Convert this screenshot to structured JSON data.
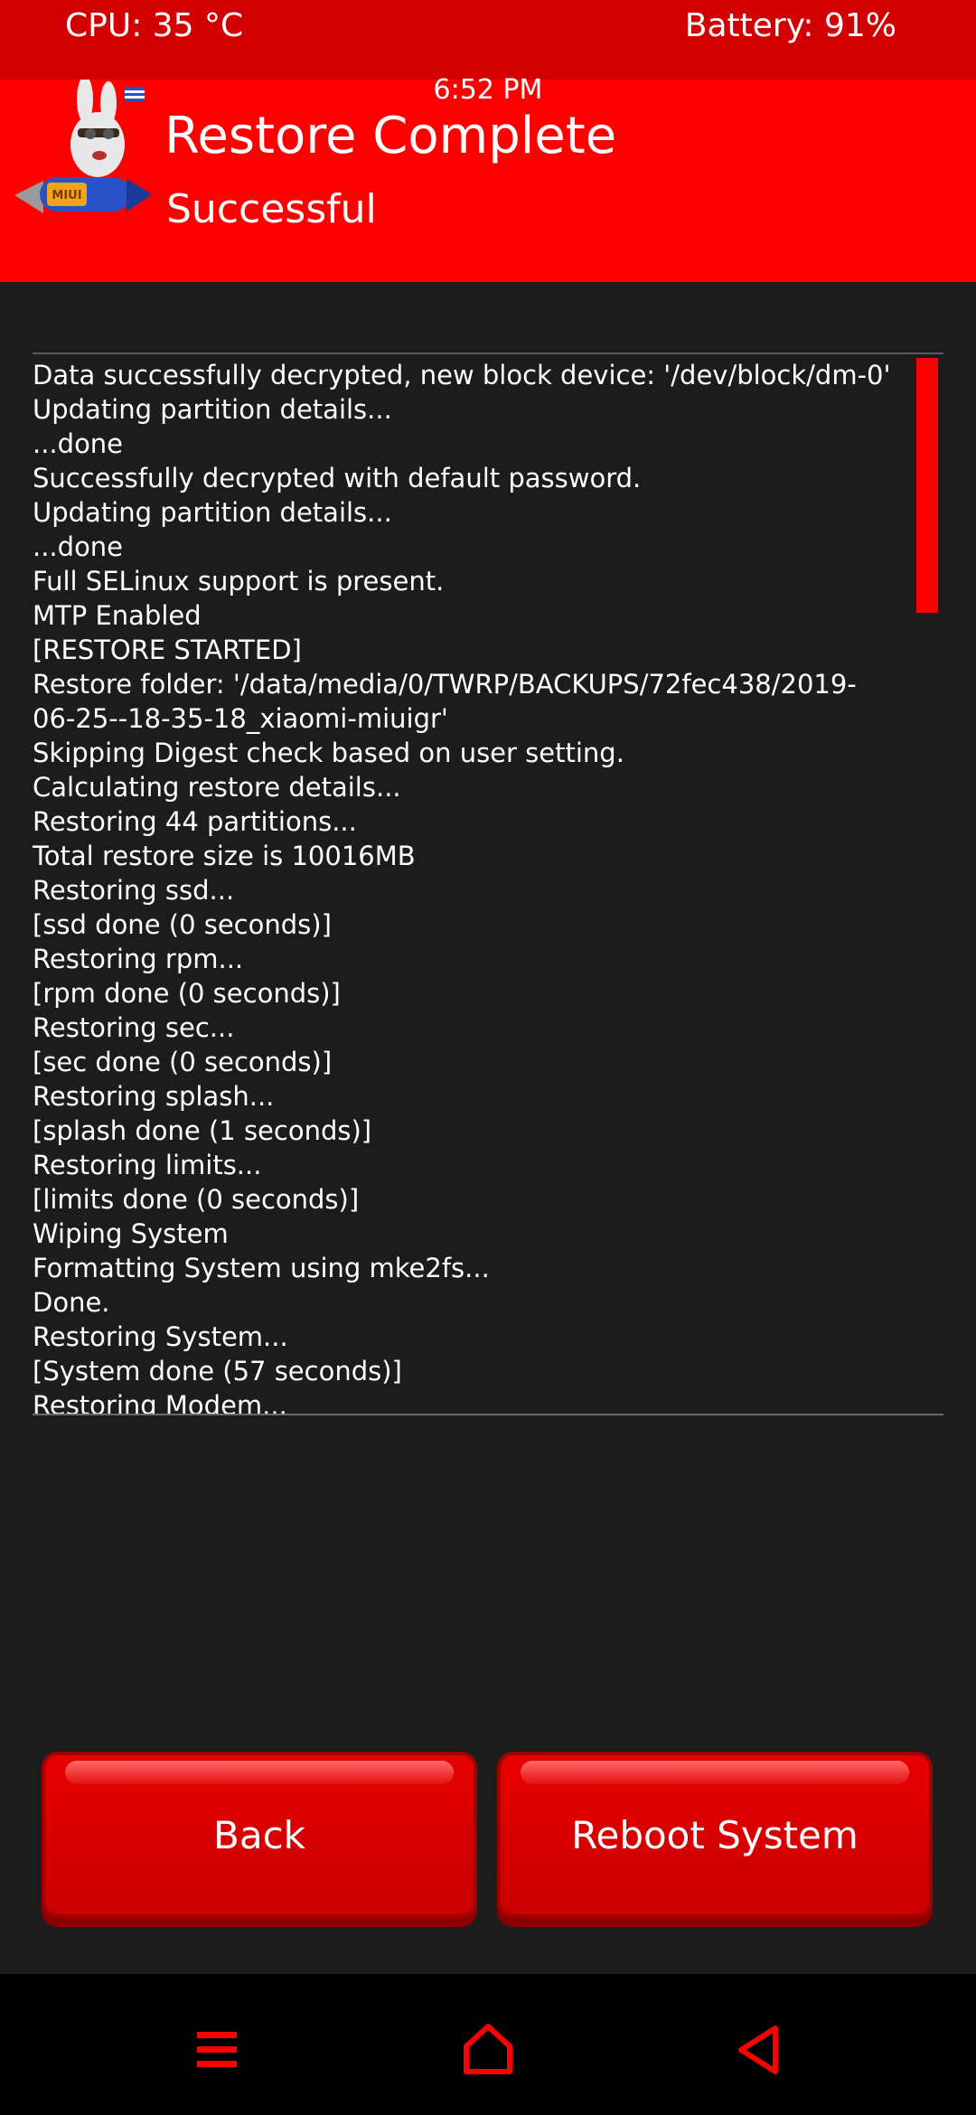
{
  "status_bar": {
    "cpu": "CPU: 35 °C",
    "battery": "Battery: 91%"
  },
  "header": {
    "time": "6:52 PM",
    "title": "Restore Complete",
    "subtitle": "Successful",
    "logo_icon": "miui-rocket-logo",
    "logo_text": "MIUI"
  },
  "console": {
    "lines": [
      "Data successfully decrypted, new block device: '/dev/block/dm-0'",
      "Updating partition details...",
      "...done",
      "Successfully decrypted with default password.",
      "Updating partition details...",
      "...done",
      "Full SELinux support is present.",
      "MTP Enabled",
      "[RESTORE STARTED]",
      "Restore folder: '/data/media/0/TWRP/BACKUPS/72fec438/2019-",
      "06-25--18-35-18_xiaomi-miuigr'",
      "Skipping Digest check based on user setting.",
      "Calculating restore details...",
      "Restoring 44 partitions...",
      "Total restore size is 10016MB",
      "Restoring ssd...",
      "[ssd done (0 seconds)]",
      "Restoring rpm...",
      "[rpm done (0 seconds)]",
      "Restoring sec...",
      "[sec done (0 seconds)]",
      "Restoring splash...",
      "[splash done (1 seconds)]",
      "Restoring limits...",
      "[limits done (0 seconds)]",
      "Wiping System",
      "Formatting System using mke2fs...",
      "Done.",
      "Restoring System...",
      "[System done (57 seconds)]",
      "Restoring Modem..."
    ]
  },
  "buttons": {
    "back": "Back",
    "reboot": "Reboot System"
  },
  "nav": {
    "menu_icon": "menu-icon",
    "home_icon": "home-icon",
    "back_icon": "back-triangle-icon"
  },
  "colors": {
    "accent": "#ff0000",
    "status_bar": "#d20000",
    "background": "#1c1c1c",
    "navbar": "#000000"
  }
}
